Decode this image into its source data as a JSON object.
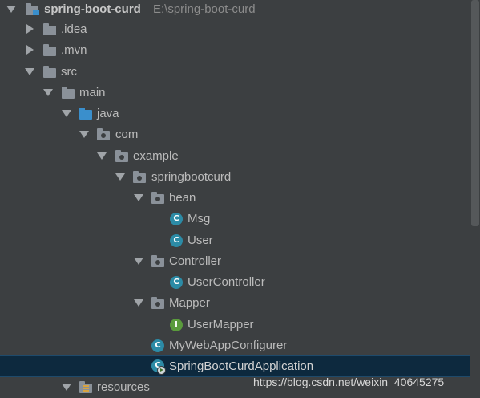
{
  "project": {
    "name": "spring-boot-curd",
    "path": "E:\\spring-boot-curd"
  },
  "tree": {
    "idea": ".idea",
    "mvn": ".mvn",
    "src": "src",
    "main": "main",
    "java": "java",
    "com": "com",
    "example": "example",
    "springbootcurd": "springbootcurd",
    "bean": "bean",
    "msg": "Msg",
    "user": "User",
    "controller": "Controller",
    "user_controller": "UserController",
    "mapper": "Mapper",
    "user_mapper": "UserMapper",
    "web_config": "MyWebAppConfigurer",
    "application": "SpringBootCurdApplication",
    "resources": "resources"
  },
  "icons": {
    "class_letter": "C",
    "interface_letter": "I"
  },
  "watermark": "https://blog.csdn.net/weixin_40645275",
  "colors": {
    "background": "#3c3f41",
    "selection": "#0d293e",
    "class_icon": "#2c8ba6",
    "interface_icon": "#5a9b3c",
    "source_folder": "#3a8fcc"
  }
}
